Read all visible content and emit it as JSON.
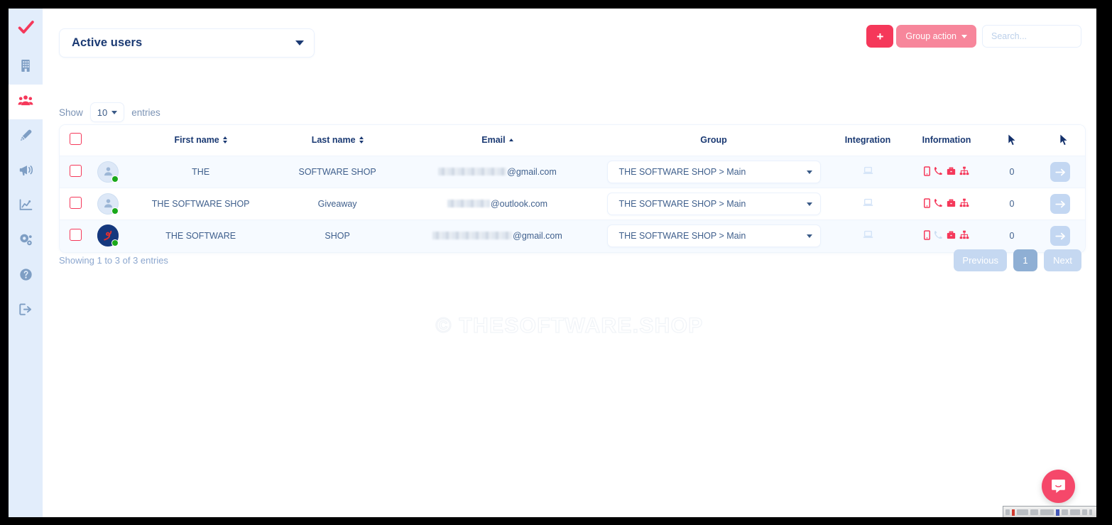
{
  "colors": {
    "accent_red": "#f5385a",
    "accent_pink": "#f7869b",
    "navy": "#1b3a73",
    "body_text": "#3f5f8c",
    "muted": "#8ca7cf",
    "row_tint": "#f6faff",
    "sidebar_bg": "#e2edfb",
    "pager_active": "#8fafd4",
    "online_green": "#1aa81a",
    "integration_icon": "#d4e4f8"
  },
  "sidebar": {
    "items": [
      {
        "name": "logo-checkmark",
        "icon": "check-icon",
        "label": "",
        "active": false
      },
      {
        "name": "sidebar-item-company",
        "icon": "building-icon",
        "label": "",
        "active": false
      },
      {
        "name": "sidebar-item-users",
        "icon": "users-icon",
        "label": "",
        "active": true
      },
      {
        "name": "sidebar-item-design",
        "icon": "pen-nib-icon",
        "label": "",
        "active": false
      },
      {
        "name": "sidebar-item-campaigns",
        "icon": "megaphone-icon",
        "label": "",
        "active": false
      },
      {
        "name": "sidebar-item-statistics",
        "icon": "chart-line-icon",
        "label": "",
        "active": false
      },
      {
        "name": "sidebar-item-settings",
        "icon": "gears-icon",
        "label": "",
        "active": false
      },
      {
        "name": "sidebar-item-help",
        "icon": "question-circle-icon",
        "label": "",
        "active": false
      },
      {
        "name": "sidebar-item-logout",
        "icon": "sign-out-icon",
        "label": "",
        "active": false
      }
    ]
  },
  "toolbar": {
    "filter_value": "Active users",
    "add_label": "+",
    "group_action_label": "Group action",
    "search_placeholder": "Search...",
    "search_value": ""
  },
  "length_menu": {
    "prefix": "Show",
    "value": "10",
    "suffix": "entries"
  },
  "table": {
    "columns": [
      {
        "key": "select",
        "label": "",
        "sort": "none"
      },
      {
        "key": "avatar",
        "label": "",
        "sort": "none"
      },
      {
        "key": "first_name",
        "label": "First name",
        "sort": "both"
      },
      {
        "key": "last_name",
        "label": "Last name",
        "sort": "both"
      },
      {
        "key": "email",
        "label": "Email",
        "sort": "asc"
      },
      {
        "key": "group",
        "label": "Group",
        "sort": "none"
      },
      {
        "key": "integration",
        "label": "Integration",
        "sort": "none"
      },
      {
        "key": "information",
        "label": "Information",
        "sort": "none"
      },
      {
        "key": "count",
        "label": "",
        "sort": "none"
      },
      {
        "key": "action",
        "label": "",
        "sort": "none"
      }
    ],
    "rows": [
      {
        "selected": false,
        "avatar_type": "placeholder",
        "online": true,
        "first_name": "THE",
        "last_name": "SOFTWARE SHOP",
        "email_redacted_width": 96,
        "email_domain": "@gmail.com",
        "group": "THE SOFTWARE SHOP > Main",
        "integration_icon": "laptop-icon",
        "info_icons": [
          {
            "name": "mobile-icon",
            "active": true
          },
          {
            "name": "phone-icon",
            "active": true
          },
          {
            "name": "briefcase-icon",
            "active": true
          },
          {
            "name": "sitemap-icon",
            "active": true
          }
        ],
        "count": "0",
        "action_icon": "arrow-right-icon"
      },
      {
        "selected": false,
        "avatar_type": "placeholder",
        "online": true,
        "first_name": "THE SOFTWARE SHOP",
        "last_name": "Giveaway",
        "email_redacted_width": 60,
        "email_domain": "@outlook.com",
        "group": "THE SOFTWARE SHOP > Main",
        "integration_icon": "laptop-icon",
        "info_icons": [
          {
            "name": "mobile-icon",
            "active": true
          },
          {
            "name": "phone-icon",
            "active": true
          },
          {
            "name": "briefcase-icon",
            "active": true
          },
          {
            "name": "sitemap-icon",
            "active": true
          }
        ],
        "count": "0",
        "action_icon": "arrow-right-icon"
      },
      {
        "selected": false,
        "avatar_type": "photo",
        "online": true,
        "first_name": "THE SOFTWARE",
        "last_name": "SHOP",
        "email_redacted_width": 112,
        "email_domain": "@gmail.com",
        "group": "THE SOFTWARE SHOP > Main",
        "integration_icon": "laptop-icon",
        "info_icons": [
          {
            "name": "mobile-icon",
            "active": true
          },
          {
            "name": "phone-icon",
            "active": false
          },
          {
            "name": "briefcase-icon",
            "active": true
          },
          {
            "name": "sitemap-icon",
            "active": true
          }
        ],
        "count": "0",
        "action_icon": "arrow-right-icon"
      }
    ]
  },
  "footer": {
    "showing": "Showing 1 to 3 of 3 entries",
    "previous_label": "Previous",
    "page_label": "1",
    "next_label": "Next"
  },
  "watermark": "© THESOFTWARE.SHOP"
}
